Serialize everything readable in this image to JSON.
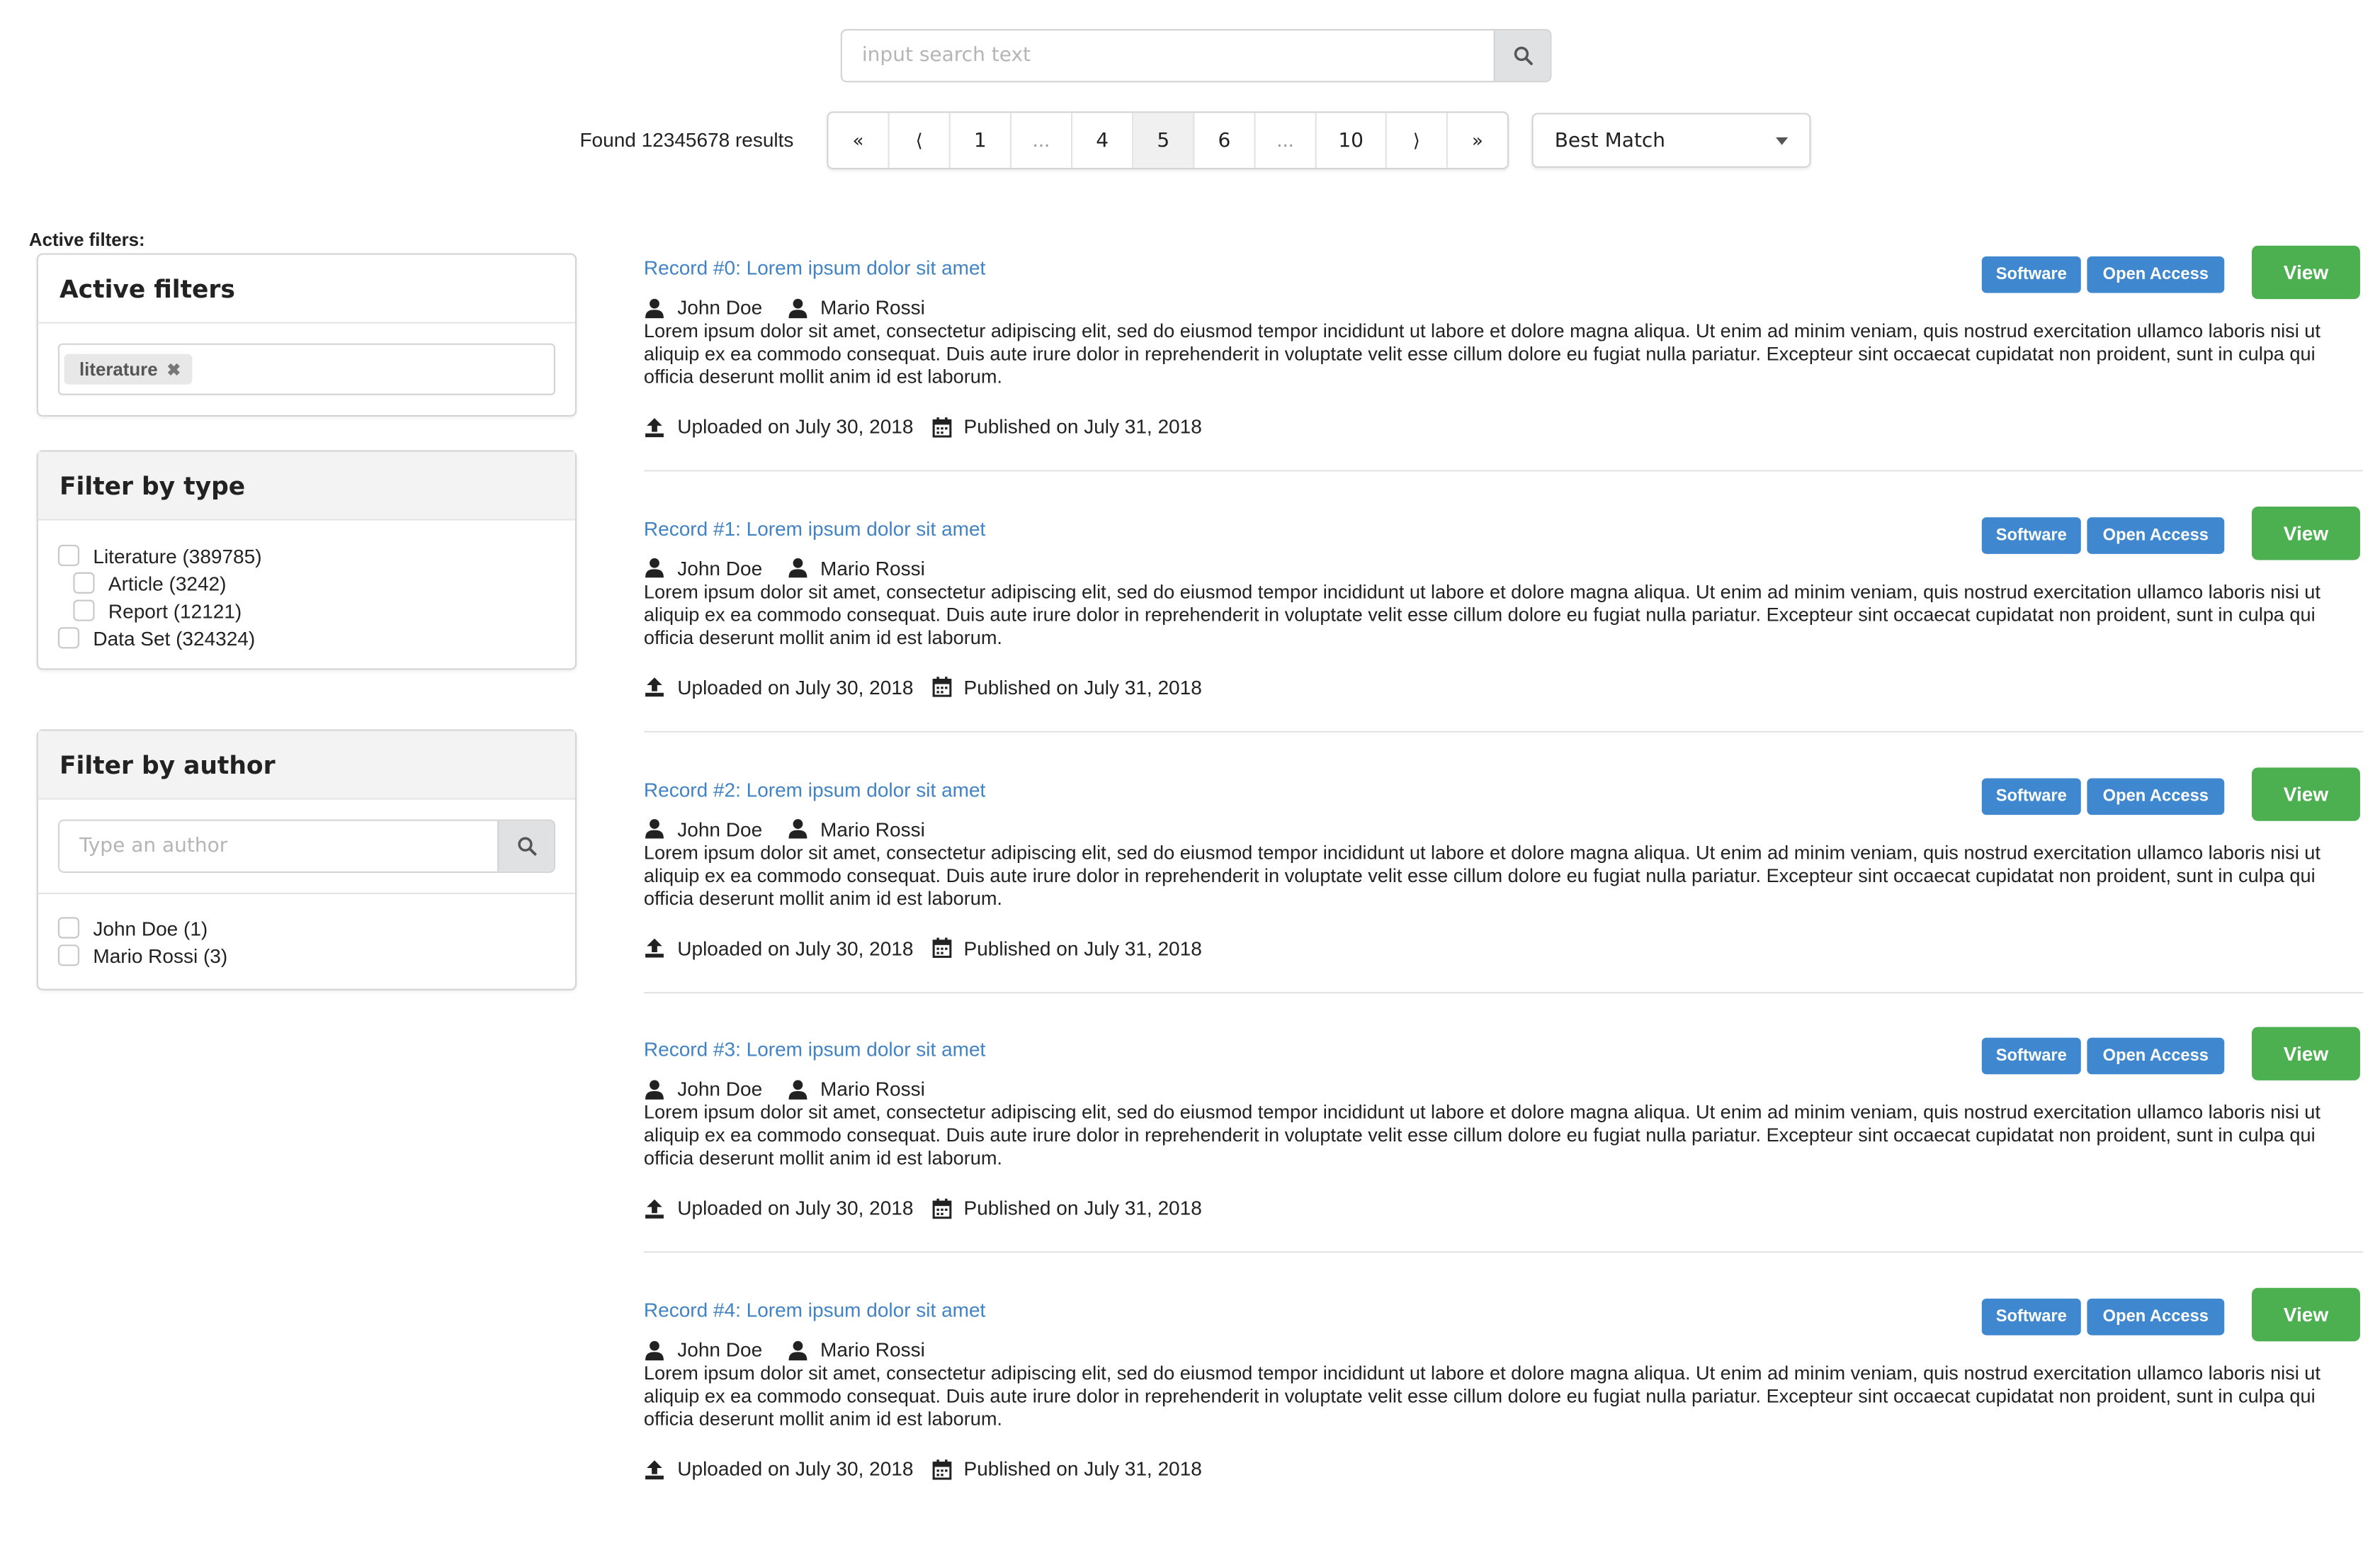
{
  "search": {
    "placeholder": "input search text"
  },
  "results": {
    "found_text": "Found 12345678 results"
  },
  "pagination": {
    "items": [
      {
        "label": "«",
        "kind": "arrow"
      },
      {
        "label": "⟨",
        "kind": "arrow"
      },
      {
        "label": "1",
        "kind": "page"
      },
      {
        "label": "...",
        "kind": "dots"
      },
      {
        "label": "4",
        "kind": "page"
      },
      {
        "label": "5",
        "kind": "page",
        "active": true
      },
      {
        "label": "6",
        "kind": "page"
      },
      {
        "label": "...",
        "kind": "dots"
      },
      {
        "label": "10",
        "kind": "page"
      },
      {
        "label": "⟩",
        "kind": "arrow"
      },
      {
        "label": "»",
        "kind": "arrow"
      }
    ]
  },
  "sort": {
    "selected": "Best Match"
  },
  "sidebar": {
    "active_filters_label": "Active filters:",
    "active_filters": {
      "title": "Active filters",
      "chips": [
        "literature"
      ]
    },
    "filter_type": {
      "title": "Filter by type",
      "items": [
        {
          "label": "Literature (389785)",
          "level": 0
        },
        {
          "label": "Article (3242)",
          "level": 1
        },
        {
          "label": "Report (12121)",
          "level": 1
        },
        {
          "label": "Data Set (324324)",
          "level": 0
        }
      ]
    },
    "filter_author": {
      "title": "Filter by author",
      "placeholder": "Type an author",
      "items": [
        {
          "label": "John Doe (1)"
        },
        {
          "label": "Mario Rossi (3)"
        }
      ]
    }
  },
  "records": [
    {
      "title": "Record #0: Lorem ipsum dolor sit amet",
      "badges": [
        "Software",
        "Open Access"
      ],
      "view": "View",
      "authors": [
        "John Doe",
        "Mario Rossi"
      ],
      "description": "Lorem ipsum dolor sit amet, consectetur adipiscing elit, sed do eiusmod tempor incididunt ut labore et dolore magna aliqua. Ut enim ad minim veniam, quis nostrud exercitation ullamco laboris nisi ut aliquip ex ea commodo consequat. Duis aute irure dolor in reprehenderit in voluptate velit esse cillum dolore eu fugiat nulla pariatur. Excepteur sint occaecat cupidatat non proident, sunt in culpa qui officia deserunt mollit anim id est laborum.",
      "uploaded": "Uploaded on July 30, 2018",
      "published": "Published on July 31, 2018"
    },
    {
      "title": "Record #1: Lorem ipsum dolor sit amet",
      "badges": [
        "Software",
        "Open Access"
      ],
      "view": "View",
      "authors": [
        "John Doe",
        "Mario Rossi"
      ],
      "description": "Lorem ipsum dolor sit amet, consectetur adipiscing elit, sed do eiusmod tempor incididunt ut labore et dolore magna aliqua. Ut enim ad minim veniam, quis nostrud exercitation ullamco laboris nisi ut aliquip ex ea commodo consequat. Duis aute irure dolor in reprehenderit in voluptate velit esse cillum dolore eu fugiat nulla pariatur. Excepteur sint occaecat cupidatat non proident, sunt in culpa qui officia deserunt mollit anim id est laborum.",
      "uploaded": "Uploaded on July 30, 2018",
      "published": "Published on July 31, 2018"
    },
    {
      "title": "Record #2: Lorem ipsum dolor sit amet",
      "badges": [
        "Software",
        "Open Access"
      ],
      "view": "View",
      "authors": [
        "John Doe",
        "Mario Rossi"
      ],
      "description": "Lorem ipsum dolor sit amet, consectetur adipiscing elit, sed do eiusmod tempor incididunt ut labore et dolore magna aliqua. Ut enim ad minim veniam, quis nostrud exercitation ullamco laboris nisi ut aliquip ex ea commodo consequat. Duis aute irure dolor in reprehenderit in voluptate velit esse cillum dolore eu fugiat nulla pariatur. Excepteur sint occaecat cupidatat non proident, sunt in culpa qui officia deserunt mollit anim id est laborum.",
      "uploaded": "Uploaded on July 30, 2018",
      "published": "Published on July 31, 2018"
    },
    {
      "title": "Record #3: Lorem ipsum dolor sit amet",
      "badges": [
        "Software",
        "Open Access"
      ],
      "view": "View",
      "authors": [
        "John Doe",
        "Mario Rossi"
      ],
      "description": "Lorem ipsum dolor sit amet, consectetur adipiscing elit, sed do eiusmod tempor incididunt ut labore et dolore magna aliqua. Ut enim ad minim veniam, quis nostrud exercitation ullamco laboris nisi ut aliquip ex ea commodo consequat. Duis aute irure dolor in reprehenderit in voluptate velit esse cillum dolore eu fugiat nulla pariatur. Excepteur sint occaecat cupidatat non proident, sunt in culpa qui officia deserunt mollit anim id est laborum.",
      "uploaded": "Uploaded on July 30, 2018",
      "published": "Published on July 31, 2018"
    },
    {
      "title": "Record #4: Lorem ipsum dolor sit amet",
      "badges": [
        "Software",
        "Open Access"
      ],
      "view": "View",
      "authors": [
        "John Doe",
        "Mario Rossi"
      ],
      "description": "Lorem ipsum dolor sit amet, consectetur adipiscing elit, sed do eiusmod tempor incididunt ut labore et dolore magna aliqua. Ut enim ad minim veniam, quis nostrud exercitation ullamco laboris nisi ut aliquip ex ea commodo consequat. Duis aute irure dolor in reprehenderit in voluptate velit esse cillum dolore eu fugiat nulla pariatur. Excepteur sint occaecat cupidatat non proident, sunt in culpa qui officia deserunt mollit anim id est laborum.",
      "uploaded": "Uploaded on July 30, 2018",
      "published": "Published on July 31, 2018"
    }
  ],
  "colors": {
    "link": "#4183c4",
    "badge": "#3f88d0",
    "view_button": "#4caf50"
  },
  "icons": {
    "search": "search-icon",
    "author": "user-icon",
    "upload": "upload-icon",
    "calendar": "calendar-icon",
    "remove": "close-icon",
    "dropdown": "caret-down-icon"
  }
}
